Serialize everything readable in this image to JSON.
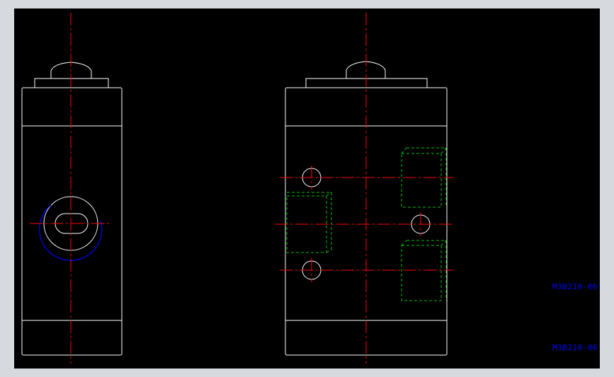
{
  "drawing": {
    "labels": [
      "M3B210-06",
      "M3B210-06"
    ],
    "colors": {
      "canvas_background": "#000000",
      "frame": "#d6d9de",
      "outline": "#ffffff",
      "centerline": "#ff0000",
      "hidden_line": "#00c000",
      "annotation": "#0000ff"
    }
  }
}
